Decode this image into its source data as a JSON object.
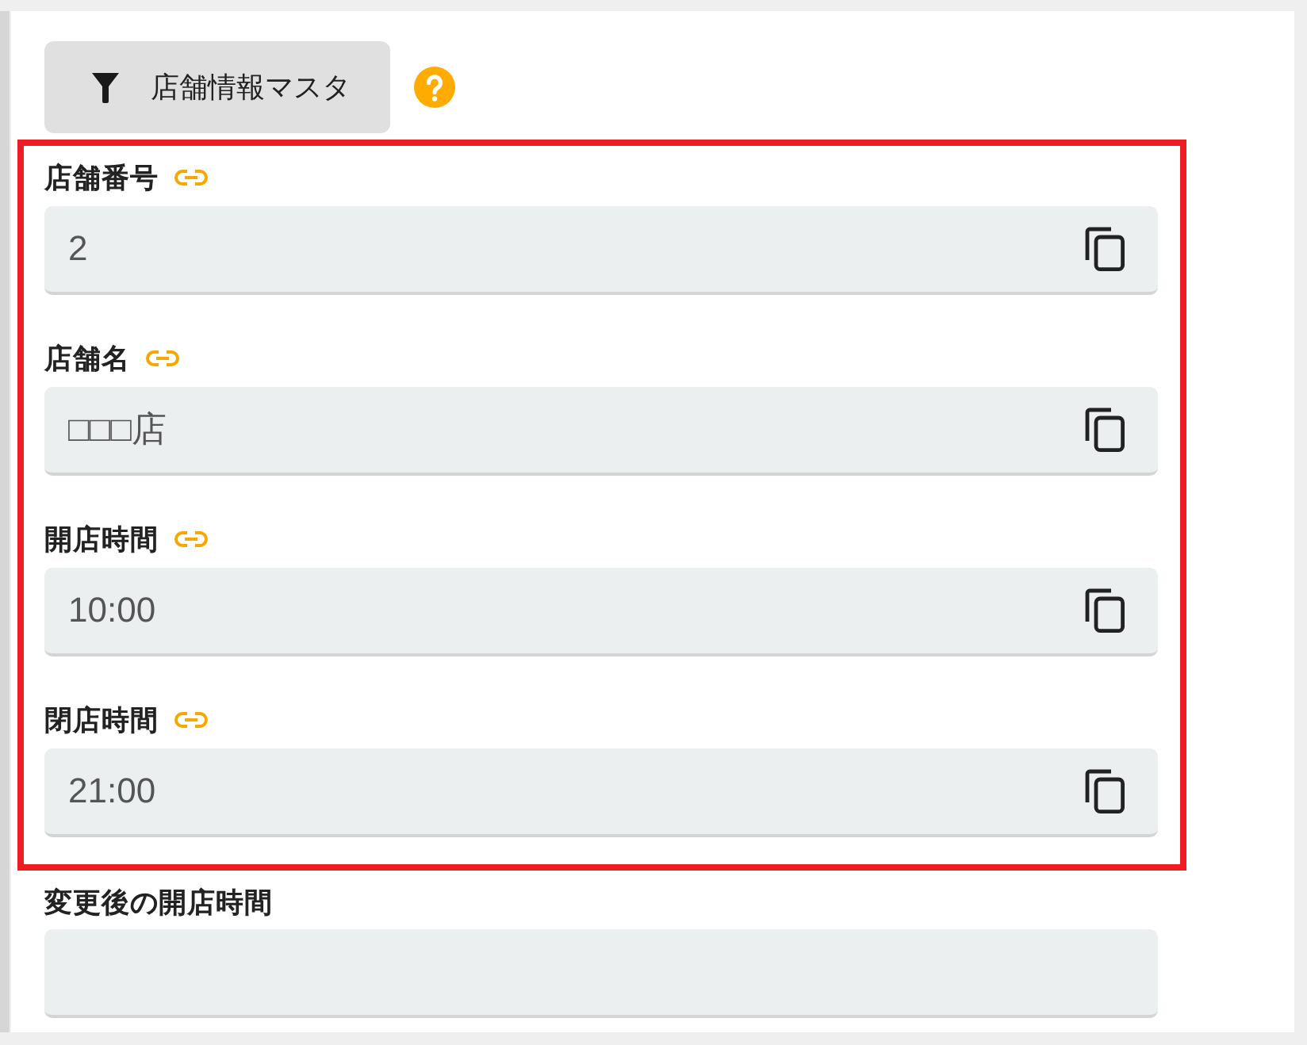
{
  "toolbar": {
    "filter_button": {
      "label": "店舗情報マスタ"
    }
  },
  "fields": [
    {
      "label": "店舗番号",
      "value": "2",
      "linked": true,
      "copyable": true,
      "highlighted": true
    },
    {
      "label": "店舗名",
      "value": "□□□店",
      "linked": true,
      "copyable": true,
      "highlighted": true
    },
    {
      "label": "開店時間",
      "value": "10:00",
      "linked": true,
      "copyable": true,
      "highlighted": true
    },
    {
      "label": "閉店時間",
      "value": "21:00",
      "linked": true,
      "copyable": true,
      "highlighted": true
    },
    {
      "label": "変更後の開店時間",
      "linked": false,
      "copyable": false,
      "highlighted": false
    }
  ]
}
